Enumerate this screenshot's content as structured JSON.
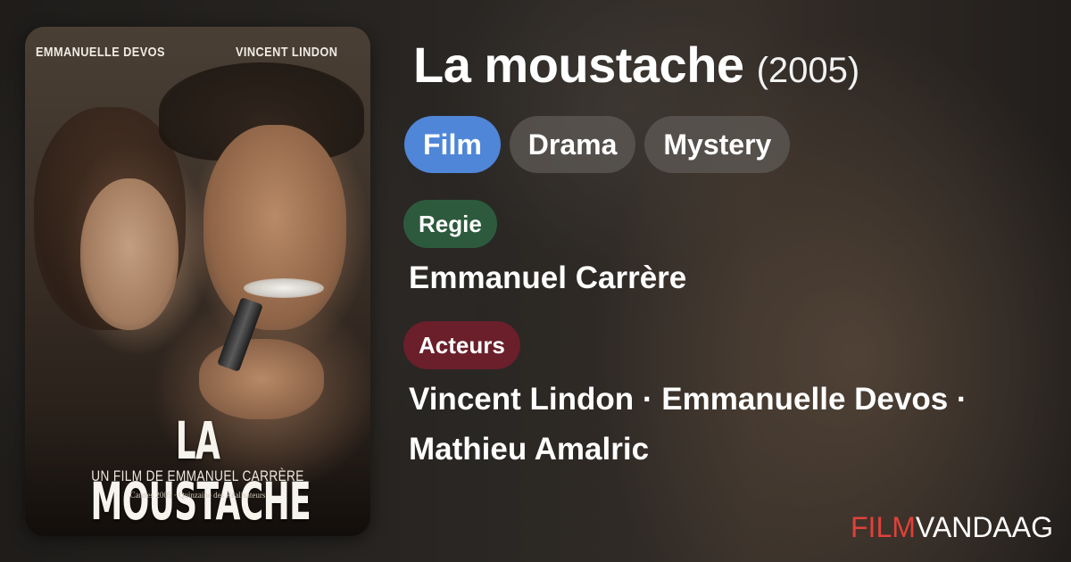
{
  "movie": {
    "title": "La moustache",
    "year": "(2005)"
  },
  "genres": [
    "Film",
    "Drama",
    "Mystery"
  ],
  "director": {
    "label": "Regie",
    "name": "Emmanuel Carrère"
  },
  "actors": {
    "label": "Acteurs",
    "line1": "Vincent Lindon · Emmanuelle Devos ·",
    "line2": "Mathieu Amalric"
  },
  "poster": {
    "actor_left": "EMMANUELLE DEVOS",
    "actor_right": "VINCENT LINDON",
    "title": "LA MOUSTACHE",
    "subtitle": "UN FILM DE EMMANUEL CARRÈRE",
    "festival": "Cannes 2005 · Quinzaine des Réalisateurs"
  },
  "brand": {
    "part1": "FILM",
    "part2": "VANDAAG"
  },
  "colors": {
    "film_pill": "#4f86d8",
    "regie_badge": "#2d5a3d",
    "acteurs_badge": "#6a1f2b",
    "brand_red": "#e0413a"
  }
}
